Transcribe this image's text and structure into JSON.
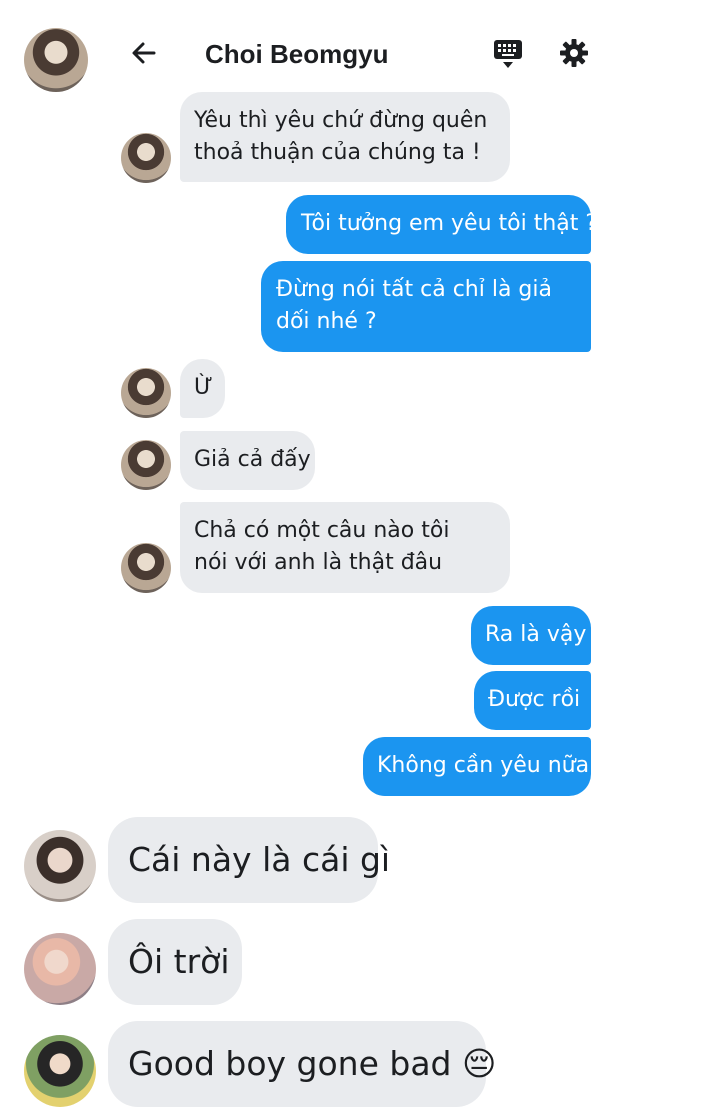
{
  "header": {
    "title": "Choi Beomgyu",
    "back_icon": "arrow-left-icon",
    "keyboard_icon": "keyboard-icon",
    "settings_icon": "gear-icon"
  },
  "chat": {
    "messages": [
      {
        "from": "contact",
        "text": "Yêu thì yêu chứ đừng quên thoả thuận của chúng ta !"
      },
      {
        "from": "me",
        "text": "Tôi tưởng em yêu tôi thật ?"
      },
      {
        "from": "me",
        "text": "Đừng nói tất cả chỉ là giả dối nhé ?"
      },
      {
        "from": "contact",
        "text": "Ừ"
      },
      {
        "from": "contact",
        "text": "Giả cả đấy"
      },
      {
        "from": "contact",
        "text": "Chả có một câu nào tôi nói với anh là thật đâu"
      },
      {
        "from": "me",
        "text": "Ra là vậy"
      },
      {
        "from": "me",
        "text": "Được rồi"
      },
      {
        "from": "me",
        "text": "Không cần yêu nữa"
      }
    ]
  },
  "comments": [
    {
      "text": "Cái này là cái gì"
    },
    {
      "text": "Ôi trời"
    },
    {
      "text": "Good boy gone bad 😔"
    }
  ],
  "colors": {
    "outgoing": "#1b95f0",
    "incoming": "#e9ebee",
    "background": "#ffffff"
  }
}
